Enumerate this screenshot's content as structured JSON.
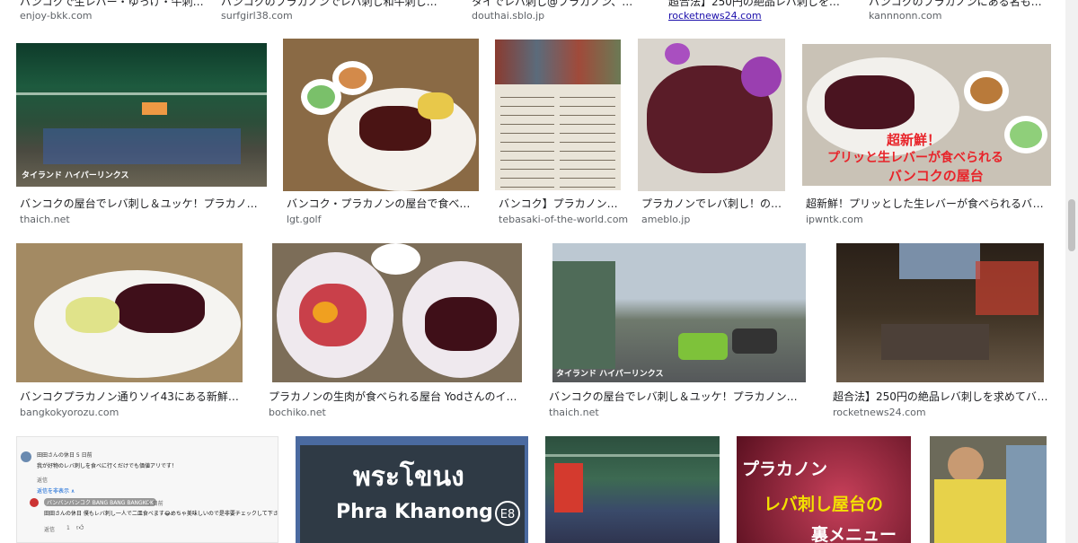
{
  "top_row": [
    {
      "title": "バンコクで生レバー・ゆっけ・牛刺…",
      "source": "enjoy-bkk.com"
    },
    {
      "title": "バンコクのプラカノンでレバ刺し和牛刺しが食べ…",
      "source": "surfgirl38.com"
    },
    {
      "title": "タイでレバ刺し@プラカノン、ヒラ…",
      "source": "douthai.sblo.jp"
    },
    {
      "title": "超合法】250円の絶品レバ刺しを求め…",
      "source": "rocketnews24.com"
    },
    {
      "title": "バンコクのプラカノンにある名もな…",
      "source": "kannnonn.com"
    }
  ],
  "row2": [
    {
      "title": "バンコクの屋台でレバ刺し＆ユッケ！プラカノン…",
      "source": "thaich.net",
      "overlay": "タイランド ハイパーリンクス"
    },
    {
      "title": "バンコク・プラカノンの屋台で食べれ…",
      "source": "lgt.golf"
    },
    {
      "title": "バンコク】プラカノン…",
      "source": "tebasaki-of-the-world.com"
    },
    {
      "title": "プラカノンでレバ刺し！の…",
      "source": "ameblo.jp"
    },
    {
      "title": "超新鮮！プリッとした生レバーが食べられるバン…",
      "source": "ipwntk.com",
      "overlay_lines": [
        "超新鮮！",
        "プリッと生レバーが食べられる",
        "バンコクの屋台"
      ]
    }
  ],
  "row3": [
    {
      "title": "バンコクプラカノン通りソイ43にある新鮮なレ…",
      "source": "bangkokyorozu.com"
    },
    {
      "title": "プラカノンの生肉が食べられる屋台 Yodさんのイサー…",
      "source": "bochiko.net"
    },
    {
      "title": "バンコクの屋台でレバ刺し＆ユッケ！プラカノン「ラ…",
      "source": "thaich.net",
      "overlay": "タイランド ハイパーリンクス"
    },
    {
      "title": "超合法】250円の絶品レバ刺しを求めてバン…",
      "source": "rocketnews24.com"
    }
  ],
  "row4": {
    "comment": {
      "user1": "田田さんの休日  5 日前",
      "text1": "我が好物のレバ刺しを食べに行くだけでも価値アリです！",
      "reply_label": "返信",
      "hide_replies": "返信を非表示 ∧",
      "channel": "バンバンバンコク BANG BANG BANGKOK",
      "time2": "5 日前",
      "text2": "田田さんの休日 僕もレバ刺し一人で二皿食べます😂めちゃ美味しいので是非要チェックして下さい",
      "likes": "1"
    },
    "sign": {
      "thai": "พระโขนง",
      "latin": "Phra Khanong",
      "code": "E8"
    },
    "menu_overlay": [
      "プラカノン",
      "レバ刺し屋台の",
      "裏メニュー"
    ]
  }
}
